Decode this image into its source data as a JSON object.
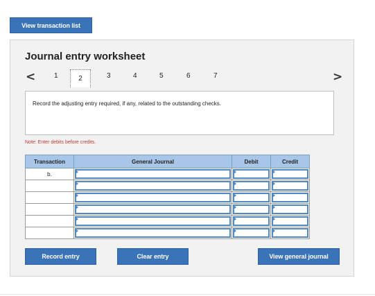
{
  "top_button_label": "View transaction list",
  "worksheet": {
    "title": "Journal entry worksheet",
    "pages": [
      "1",
      "2",
      "3",
      "4",
      "5",
      "6",
      "7"
    ],
    "active_page": "2",
    "prev_glyph": "<",
    "next_glyph": ">",
    "instruction": "Record the adjusting entry required, if any, related to the outstanding checks.",
    "note": "Note: Enter debits before credits."
  },
  "table": {
    "headers": [
      "Transaction",
      "General Journal",
      "Debit",
      "Credit"
    ],
    "rows": [
      {
        "transaction": "b."
      },
      {
        "transaction": ""
      },
      {
        "transaction": ""
      },
      {
        "transaction": ""
      },
      {
        "transaction": ""
      },
      {
        "transaction": ""
      }
    ]
  },
  "buttons": {
    "record": "Record entry",
    "clear": "Clear entry",
    "view_journal": "View general journal"
  },
  "colors": {
    "button": "#3b73b9",
    "header": "#a7c6e8",
    "input_border": "#4f88c4",
    "note": "#c0392b"
  }
}
